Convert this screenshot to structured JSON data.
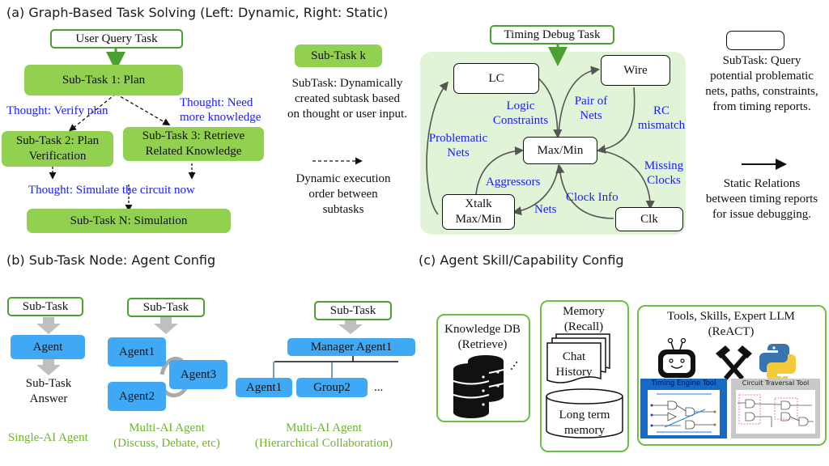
{
  "section_a": {
    "title": "(a) Graph-Based Task Solving (Left: Dynamic, Right: Static)",
    "dynamic": {
      "user_query": "User Query Task",
      "subtask1": "Sub-Task 1: Plan",
      "thought_verify": "Thought: Verify plan",
      "thought_need_l1": "Thought: Need",
      "thought_need_l2": "more knowledge",
      "subtask2_l1": "Sub-Task 2: Plan",
      "subtask2_l2": "Verification",
      "subtask3_l1": "Sub-Task 3: Retrieve",
      "subtask3_l2": "Related Knowledge",
      "thought_simulate": "Thought: Simulate the circuit now",
      "subtaskN": "Sub-Task N: Simulation"
    },
    "legend_dynamic": {
      "subtask_k": "Sub-Task k",
      "subtask_desc": [
        "SubTask: Dynamically",
        "created subtask based",
        "on thought or user input."
      ],
      "arrow_desc": [
        "Dynamic execution",
        "order between",
        "subtasks"
      ]
    },
    "static": {
      "task": "Timing Debug Task",
      "nodes": {
        "lc": "LC",
        "wire": "Wire",
        "maxmin": "Max/Min",
        "xtalk_l1": "Xtalk",
        "xtalk_l2": "Max/Min",
        "clk": "Clk"
      },
      "edges": {
        "logic_l1": "Logic",
        "logic_l2": "Constraints",
        "pair_l1": "Pair of",
        "pair_l2": "Nets",
        "rc_l1": "RC",
        "rc_l2": "mismatch",
        "prob_l1": "Problematic",
        "prob_l2": "Nets",
        "aggressors": "Aggressors",
        "nets": "Nets",
        "clock_info": "Clock Info",
        "missing_l1": "Missing",
        "missing_l2": "Clocks"
      }
    },
    "legend_static": {
      "subtask_desc": [
        "SubTask: Query",
        "potential problematic",
        "nets, paths, constraints,",
        "from timing reports."
      ],
      "arrow_desc": [
        "Static Relations",
        "between timing reports",
        "for issue debugging."
      ]
    }
  },
  "section_b": {
    "title": "(b) Sub-Task Node: Agent Config",
    "single": {
      "subtask": "Sub-Task",
      "agent": "Agent",
      "answer_l1": "Sub-Task",
      "answer_l2": "Answer",
      "caption": "Single-AI Agent"
    },
    "multi": {
      "subtask": "Sub-Task",
      "agent1": "Agent1",
      "agent2": "Agent2",
      "agent3": "Agent3",
      "caption_l1": "Multi-AI Agent",
      "caption_l2": "(Discuss, Debate, etc)"
    },
    "hier": {
      "subtask": "Sub-Task",
      "manager": "Manager Agent1",
      "agent1": "Agent1",
      "group2": "Group2",
      "ellipsis": "...",
      "caption_l1": "Multi-AI Agent",
      "caption_l2": "(Hierarchical Collaboration)"
    }
  },
  "section_c": {
    "title": "(c) Agent Skill/Capability Config",
    "knowledge": {
      "l1": "Knowledge DB",
      "l2": "(Retrieve)",
      "icon": "database-icon"
    },
    "memory": {
      "l1": "Memory",
      "l2": "(Recall)",
      "chat_l1": "Chat",
      "chat_l2": "History",
      "long_l1": "Long term",
      "long_l2": "memory"
    },
    "tools": {
      "l1": "Tools, Skills, Expert LLM",
      "l2": "(ReACT)",
      "timing_tool": "Timing Engine Tool",
      "circuit_tool": "Circuit Traversal Tool",
      "icons": [
        "robot-icon",
        "hammers-icon",
        "python-icon"
      ]
    }
  },
  "colors": {
    "subtask_green": "#92d050",
    "border_green": "#4aa030",
    "thought_blue": "#1a1aff",
    "agent_blue": "#3fa9f5",
    "caption_green": "#6cb52d",
    "static_bg": "#e2f4d8"
  }
}
